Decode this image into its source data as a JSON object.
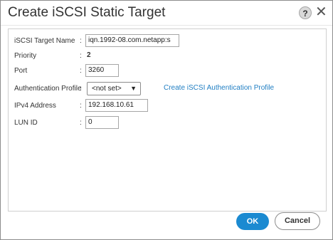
{
  "dialog": {
    "title": "Create iSCSI Static Target",
    "help_symbol": "?",
    "close_symbol": "✕"
  },
  "form": {
    "target_name": {
      "label": "iSCSI Target Name",
      "colon": ":",
      "value": "iqn.1992-08.com.netapp:s"
    },
    "priority": {
      "label": "Priority",
      "colon": ":",
      "value": "2"
    },
    "port": {
      "label": "Port",
      "colon": ":",
      "value": "3260"
    },
    "auth_profile": {
      "label": "Authentication Profile",
      "colon": ":",
      "value": "<not set>",
      "link": "Create iSCSI Authentication Profile"
    },
    "ipv4": {
      "label": "IPv4 Address",
      "colon": ":",
      "value": "192.168.10.61"
    },
    "lun_id": {
      "label": "LUN ID",
      "colon": ":",
      "value": "0"
    }
  },
  "actions": {
    "ok": "OK",
    "cancel": "Cancel"
  },
  "colors": {
    "primary": "#1b8ad1",
    "link": "#1f7ec3"
  },
  "icons": {
    "help": "help-icon",
    "close": "close-icon",
    "dropdown": "chevron-down-icon"
  }
}
